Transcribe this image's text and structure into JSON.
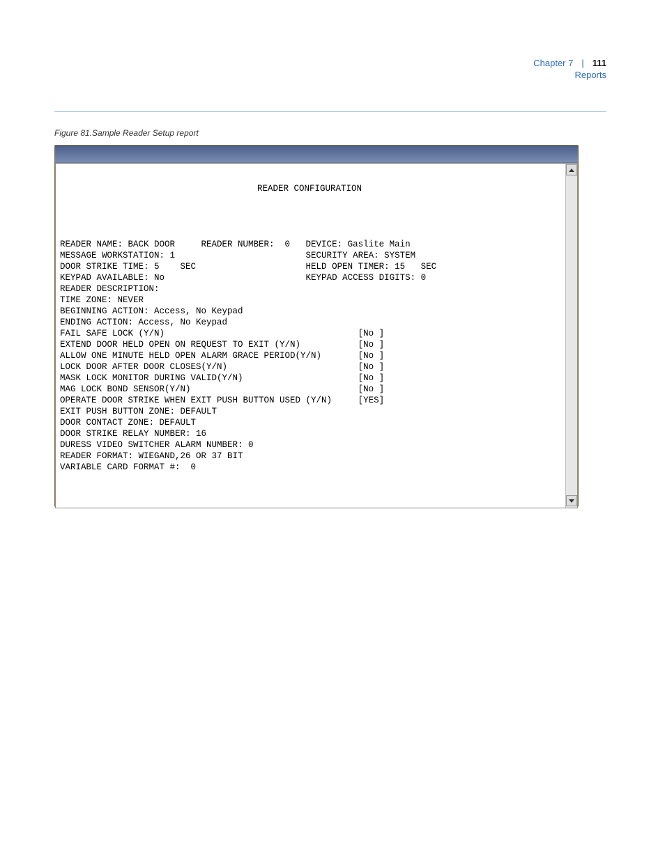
{
  "header": {
    "chapter": "Chapter 7",
    "page": "111",
    "section": "Reports"
  },
  "caption": "Figure 81.Sample Reader Setup report",
  "report": {
    "title": "READER CONFIGURATION",
    "lines": [
      "READER NAME: BACK DOOR     READER NUMBER:  0   DEVICE: Gaslite Main",
      "MESSAGE WORKSTATION: 1                         SECURITY AREA: SYSTEM",
      "DOOR STRIKE TIME: 5    SEC                     HELD OPEN TIMER: 15   SEC",
      "KEYPAD AVAILABLE: No                           KEYPAD ACCESS DIGITS: 0",
      "READER DESCRIPTION:",
      "TIME ZONE: NEVER",
      "BEGINNING ACTION: Access, No Keypad",
      "ENDING ACTION: Access, No Keypad",
      "FAIL SAFE LOCK (Y/N)                                     [No ]",
      "EXTEND DOOR HELD OPEN ON REQUEST TO EXIT (Y/N)           [No ]",
      "ALLOW ONE MINUTE HELD OPEN ALARM GRACE PERIOD(Y/N)       [No ]",
      "LOCK DOOR AFTER DOOR CLOSES(Y/N)                         [No ]",
      "MASK LOCK MONITOR DURING VALID(Y/N)                      [No ]",
      "MAG LOCK BOND SENSOR(Y/N)                                [No ]",
      "OPERATE DOOR STRIKE WHEN EXIT PUSH BUTTON USED (Y/N)     [YES]",
      "EXIT PUSH BUTTON ZONE: DEFAULT",
      "DOOR CONTACT ZONE: DEFAULT",
      "DOOR STRIKE RELAY NUMBER: 16",
      "DURESS VIDEO SWITCHER ALARM NUMBER: 0",
      "READER FORMAT: WIEGAND,26 OR 37 BIT",
      "VARIABLE CARD FORMAT #:  0"
    ]
  }
}
